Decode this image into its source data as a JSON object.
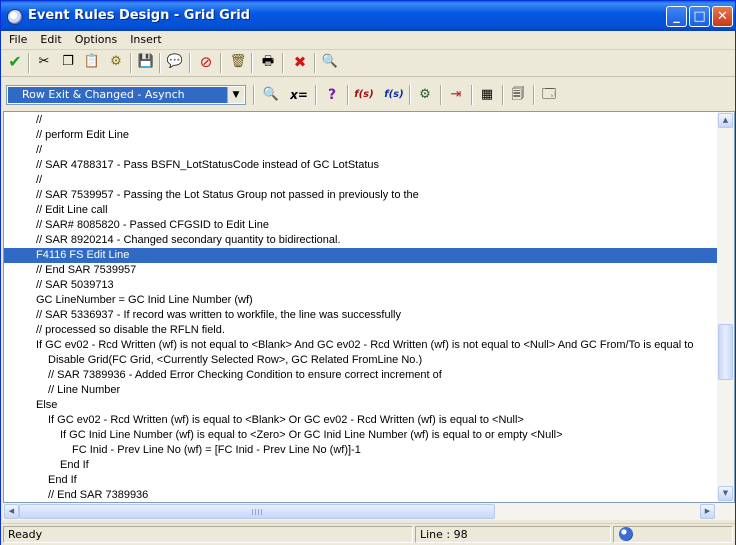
{
  "window": {
    "title": "Event Rules Design - Grid Grid",
    "controls": {
      "minimize": "_",
      "maximize": "□",
      "close": "✕"
    }
  },
  "menu": [
    "File",
    "Edit",
    "Options",
    "Insert"
  ],
  "toolbar1": {
    "icons": [
      "checkmark-icon",
      "cut-icon",
      "copy-icon",
      "paste-icon",
      "gears-icon",
      "save-icon",
      "comment-icon",
      "disable-icon",
      "delete-icon",
      "print-icon",
      "cancel-icon",
      "search-icon"
    ]
  },
  "event_selector": {
    "selected": "Row Exit & Changed - Asynch"
  },
  "toolbar2": {
    "icons": [
      "find-icon",
      "assign-icon",
      "if-icon",
      "function-icon",
      "function-s-icon",
      "bsfn-icon",
      "insert-line-icon",
      "table-io-icon",
      "form-interconnect-icon",
      "report-interconnect-icon"
    ],
    "glyphs": {
      "assign": "x=",
      "if": "?",
      "function": "f(s)",
      "function_s": "f(s)"
    }
  },
  "code_lines": [
    {
      "text": "//",
      "indent": 0
    },
    {
      "text": "// perform Edit Line",
      "indent": 0
    },
    {
      "text": "//",
      "indent": 0
    },
    {
      "text": "// SAR 4788317 - Pass BSFN_LotStatusCode instead of GC LotStatus",
      "indent": 0
    },
    {
      "text": "//",
      "indent": 0
    },
    {
      "text": "// SAR 7539957 - Passing the Lot Status Group not passed in previously to the",
      "indent": 0
    },
    {
      "text": "// Edit Line call",
      "indent": 0
    },
    {
      "text": "// SAR# 8085820 - Passed CFGSID to Edit Line",
      "indent": 0
    },
    {
      "text": "// SAR 8920214 - Changed secondary quantity to bidirectional.",
      "indent": 0
    },
    {
      "text": "F4116 FS Edit Line",
      "indent": 0,
      "selected": true
    },
    {
      "text": "// End SAR 7539957",
      "indent": 0
    },
    {
      "text": "// SAR 5039713",
      "indent": 0
    },
    {
      "text": "GC LineNumber = GC Inid Line Number (wf)",
      "indent": 0
    },
    {
      "text": "// SAR 5336937 - If record was written to workfile, the line was successfully",
      "indent": 0
    },
    {
      "text": "// processed so disable the RFLN field.",
      "indent": 0
    },
    {
      "text": "If GC ev02 - Rcd Written (wf) is not equal to <Blank> And GC ev02 - Rcd Written (wf) is not equal to <Null> And GC From/To is equal to",
      "indent": 0
    },
    {
      "text": "Disable Grid(FC Grid, <Currently Selected Row>, GC Related FromLine No.)",
      "indent": 1
    },
    {
      "text": "// SAR 7389936 - Added Error Checking Condition to ensure correct increment of",
      "indent": 1
    },
    {
      "text": "// Line Number",
      "indent": 1
    },
    {
      "text": "Else",
      "indent": 0
    },
    {
      "text": "If GC ev02 - Rcd Written (wf) is equal to <Blank> Or GC ev02 - Rcd Written (wf) is equal to <Null>",
      "indent": 1
    },
    {
      "text": "If GC Inid Line Number (wf) is equal to <Zero> Or GC Inid Line Number (wf) is equal to or empty <Null>",
      "indent": 2
    },
    {
      "text": "FC Inid - Prev Line No (wf) = [FC Inid - Prev Line No (wf)]-1",
      "indent": 3
    },
    {
      "text": "End If",
      "indent": 2
    },
    {
      "text": "End If",
      "indent": 1
    },
    {
      "text": "// End SAR 7389936",
      "indent": 1
    }
  ],
  "status": {
    "text": "Ready",
    "line_label": "Line : ",
    "line_number": "98"
  },
  "colors": {
    "selection": "#316ac5",
    "titlebar": "#0758e2",
    "face": "#ece9d8"
  }
}
